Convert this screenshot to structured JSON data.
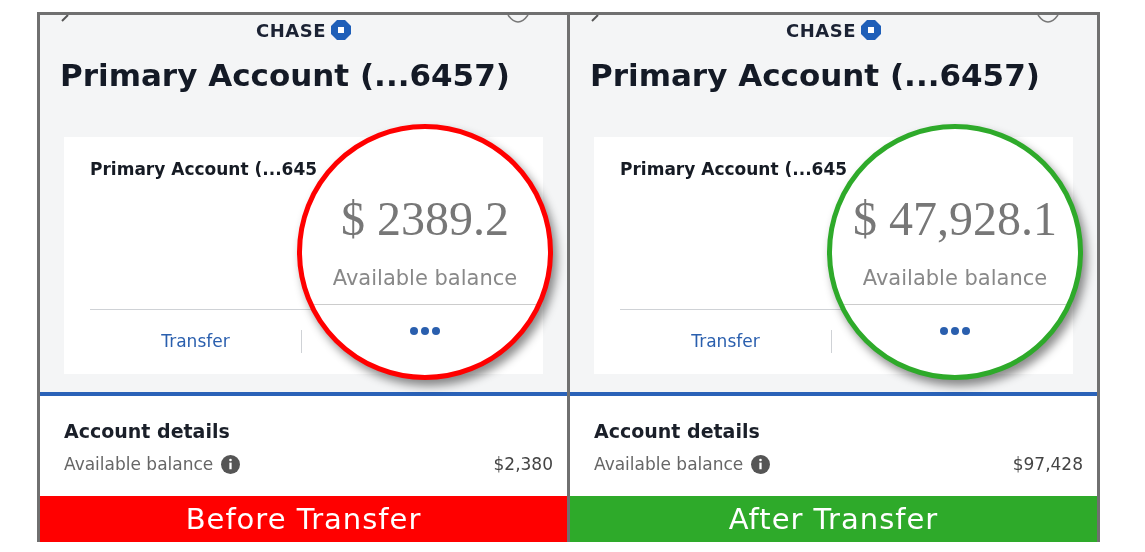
{
  "panels": [
    {
      "logo": "CHASE",
      "title": "Primary Account (...6457)",
      "card": {
        "name": "Primary Account (...645",
        "action": "Transfer"
      },
      "magnifier": {
        "amount": "$ 2389.2",
        "label": "Available balance"
      },
      "details": {
        "heading": "Account details",
        "label": "Available balance",
        "value": "$2,380"
      },
      "caption": "Before Transfer",
      "color": "#ff0000"
    },
    {
      "logo": "CHASE",
      "title": "Primary Account (...6457)",
      "card": {
        "name": "Primary Account (...645",
        "action": "Transfer"
      },
      "magnifier": {
        "amount": "$ 47,928.1",
        "label": "Available balance"
      },
      "details": {
        "heading": "Account details",
        "label": "Available balance",
        "value": "$97,428"
      },
      "caption": "After Transfer",
      "color": "#2eaa2a"
    }
  ]
}
